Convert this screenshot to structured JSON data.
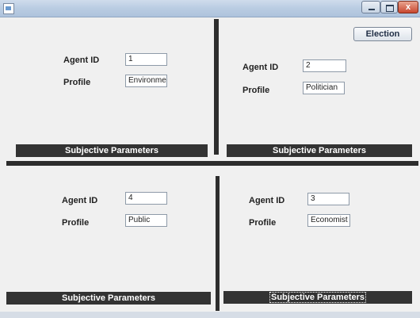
{
  "window": {
    "title": "",
    "close_label": "x"
  },
  "toolbar": {
    "election_label": "Election"
  },
  "labels": {
    "agent_id": "Agent ID",
    "profile": "Profile",
    "subjective_parameters": "Subjective Parameters"
  },
  "agents": [
    {
      "agent_id": "1",
      "profile": "Environmentalist"
    },
    {
      "agent_id": "2",
      "profile": "Politician"
    },
    {
      "agent_id": "4",
      "profile": "Public"
    },
    {
      "agent_id": "3",
      "profile": "Economist"
    }
  ]
}
